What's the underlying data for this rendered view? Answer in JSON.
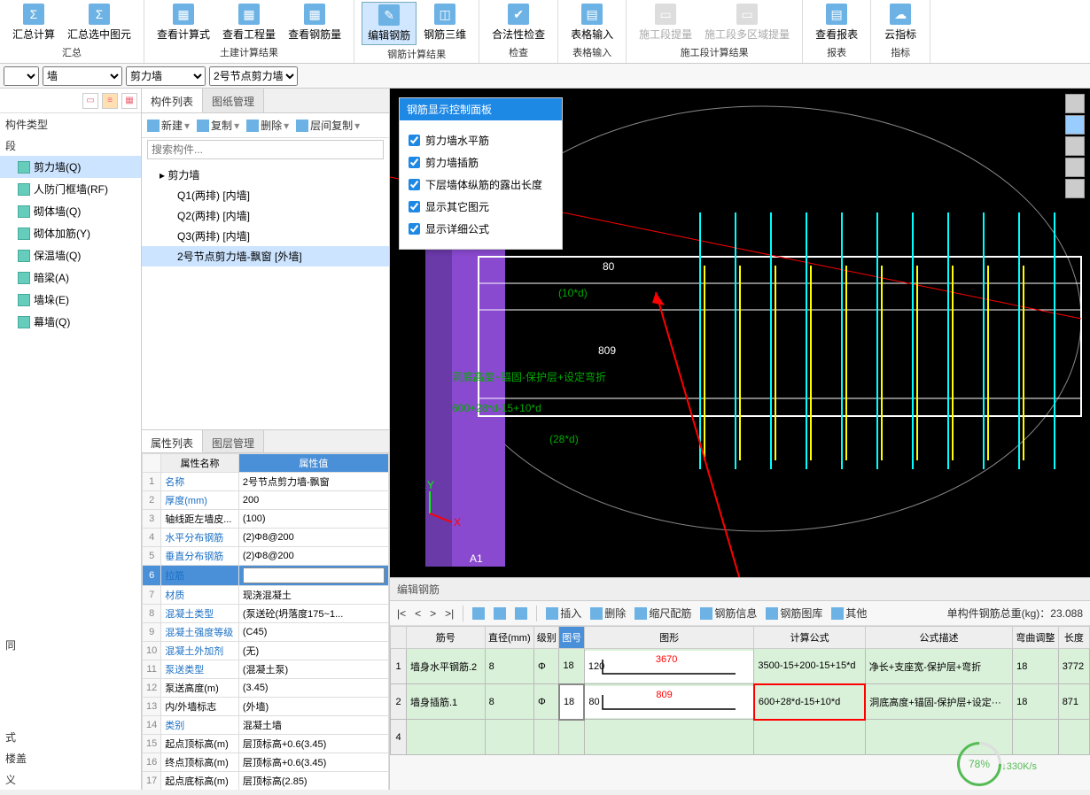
{
  "ribbon": {
    "groups": [
      {
        "label": "汇总",
        "buttons": [
          {
            "label": "汇总计算",
            "ic": "Σ"
          },
          {
            "label": "汇总选中图元",
            "ic": "Σ"
          }
        ]
      },
      {
        "label": "土建计算结果",
        "buttons": [
          {
            "label": "查看计算式",
            "ic": "▦"
          },
          {
            "label": "查看工程量",
            "ic": "▦"
          },
          {
            "label": "查看钢筋量",
            "ic": "▦"
          }
        ]
      },
      {
        "label": "钢筋计算结果",
        "buttons": [
          {
            "label": "编辑钢筋",
            "ic": "✎",
            "active": true
          },
          {
            "label": "钢筋三维",
            "ic": "◫"
          }
        ]
      },
      {
        "label": "检查",
        "buttons": [
          {
            "label": "合法性检查",
            "ic": "✔"
          }
        ]
      },
      {
        "label": "表格输入",
        "buttons": [
          {
            "label": "表格输入",
            "ic": "▤"
          }
        ]
      },
      {
        "label": "施工段计算结果",
        "buttons": [
          {
            "label": "施工段提量",
            "ic": "▭",
            "disabled": true
          },
          {
            "label": "施工段多区域提量",
            "ic": "▭",
            "disabled": true
          }
        ]
      },
      {
        "label": "报表",
        "buttons": [
          {
            "label": "查看报表",
            "ic": "▤"
          }
        ]
      },
      {
        "label": "指标",
        "buttons": [
          {
            "label": "云指标",
            "ic": "☁"
          }
        ]
      }
    ]
  },
  "dropdowns": {
    "d1": "墙",
    "d2": "剪力墙",
    "d3": "2号节点剪力墙-"
  },
  "leftHeader": "构件类型",
  "leftSub": "段",
  "leftItems": [
    {
      "label": "剪力墙(Q)",
      "sel": true
    },
    {
      "label": "人防门框墙(RF)"
    },
    {
      "label": "砌体墙(Q)"
    },
    {
      "label": "砌体加筋(Y)"
    },
    {
      "label": "保温墙(Q)"
    },
    {
      "label": "暗梁(A)"
    },
    {
      "label": "墙垛(E)"
    },
    {
      "label": "幕墙(Q)"
    }
  ],
  "leftTail": "同",
  "midTabs": [
    "构件列表",
    "图纸管理"
  ],
  "midToolbar": [
    "新建",
    "复制",
    "删除",
    "层间复制"
  ],
  "midSearchPlaceholder": "搜索构件...",
  "tree": {
    "root": "剪力墙",
    "children": [
      "Q1(两排) [内墙]",
      "Q2(两排) [内墙]",
      "Q3(两排) [内墙]",
      {
        "label": "2号节点剪力墙-飘窗 [外墙]",
        "sel": true
      }
    ]
  },
  "propTabs": [
    "属性列表",
    "图层管理"
  ],
  "propHeaders": [
    "属性名称",
    "属性值"
  ],
  "props": [
    {
      "n": "名称",
      "v": "2号节点剪力墙-飘窗",
      "link": true
    },
    {
      "n": "厚度(mm)",
      "v": "200",
      "link": true
    },
    {
      "n": "轴线距左墙皮...",
      "v": "(100)"
    },
    {
      "n": "水平分布钢筋",
      "v": "(2)Φ8@200",
      "link": true
    },
    {
      "n": "垂直分布钢筋",
      "v": "(2)Φ8@200",
      "link": true
    },
    {
      "n": "拉筋",
      "v": "",
      "sel": true,
      "link": true
    },
    {
      "n": "材质",
      "v": "现浇混凝土",
      "link": true
    },
    {
      "n": "混凝土类型",
      "v": "(泵送砼(坍落度175~1...",
      "link": true
    },
    {
      "n": "混凝土强度等级",
      "v": "(C45)",
      "link": true
    },
    {
      "n": "混凝土外加剂",
      "v": "(无)",
      "link": true
    },
    {
      "n": "泵送类型",
      "v": "(混凝土泵)",
      "link": true
    },
    {
      "n": "泵送高度(m)",
      "v": "(3.45)"
    },
    {
      "n": "内/外墙标志",
      "v": "(外墙)"
    },
    {
      "n": "类别",
      "v": "混凝土墙",
      "link": true
    },
    {
      "n": "起点顶标高(m)",
      "v": "层顶标高+0.6(3.45)"
    },
    {
      "n": "终点顶标高(m)",
      "v": "层顶标高+0.6(3.45)"
    },
    {
      "n": "起点底标高(m)",
      "v": "层顶标高(2.85)"
    }
  ],
  "leftTailItems": [
    "式",
    "楼盖",
    "义"
  ],
  "vpPanel": {
    "title": "钢筋显示控制面板",
    "checks": [
      "剪力墙水平筋",
      "剪力墙插筋",
      "下层墙体纵筋的露出长度",
      "显示其它图元",
      "显示详细公式"
    ]
  },
  "vpText": {
    "t80": "80",
    "t10d": "(10*d)",
    "t809": "809",
    "line1": "洞底高度+锚固-保护层+设定弯折",
    "line2": "600+28*d-15+10*d",
    "line3": "(28*d)",
    "a1": "A1"
  },
  "rebarPanel": {
    "title": "编辑钢筋",
    "buttonsNav": [
      "|<",
      "<",
      ">",
      ">|"
    ],
    "toolbar": [
      "插入",
      "删除",
      "缩尺配筋",
      "钢筋信息",
      "钢筋图库",
      "其他"
    ],
    "total": "单构件钢筋总重(kg)：23.088",
    "headers": [
      "筋号",
      "直径(mm)",
      "级别",
      "图号",
      "图形",
      "计算公式",
      "公式描述",
      "弯曲调整",
      "长度"
    ],
    "rows": [
      {
        "idx": "1",
        "name": "墙身水平钢筋.2",
        "dia": "8",
        "grade": "Φ",
        "no": "18",
        "s1": "120",
        "s2": "3670",
        "formula": "3500-15+200-15+15*d",
        "desc": "净长+支座宽-保护层+弯折",
        "adj": "18",
        "len": "3772"
      },
      {
        "idx": "2",
        "name": "墙身插筋.1",
        "dia": "8",
        "grade": "Φ",
        "no": "18",
        "noHl": true,
        "s1": "80",
        "s2": "809",
        "formula": "600+28*d-15+10*d",
        "formulaHl": true,
        "desc": "洞底高度+锚固-保护层+设定···",
        "adj": "18",
        "len": "871"
      },
      {
        "idx": "4"
      }
    ]
  },
  "gauge": "78%",
  "speed": "↓330K/s"
}
